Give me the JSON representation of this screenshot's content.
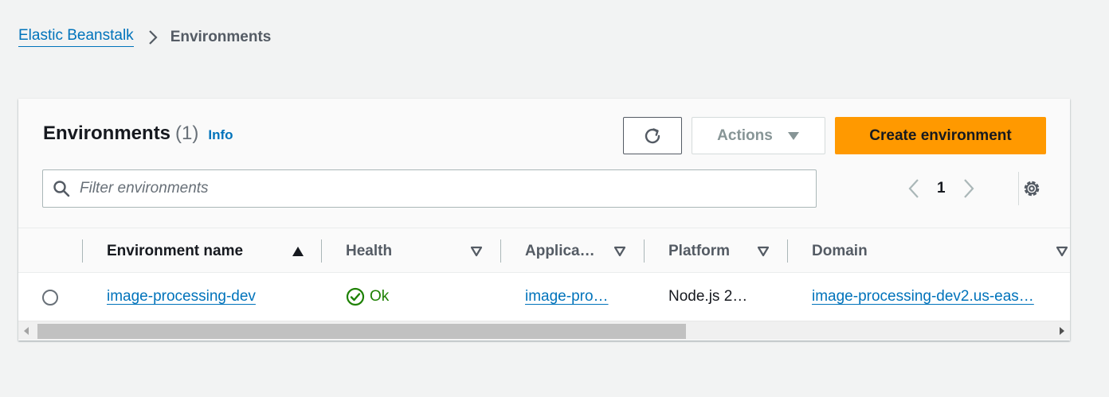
{
  "breadcrumb": {
    "root": "Elastic Beanstalk",
    "current": "Environments"
  },
  "panel": {
    "title": "Environments",
    "count": "(1)",
    "info": "Info",
    "actions_label": "Actions",
    "create_label": "Create environment",
    "filter_placeholder": "Filter environments",
    "page": "1"
  },
  "table": {
    "columns": [
      {
        "label": "Environment name",
        "sort": "ascending"
      },
      {
        "label": "Health"
      },
      {
        "label": "Applica…"
      },
      {
        "label": "Platform"
      },
      {
        "label": "Domain"
      }
    ],
    "rows": [
      {
        "environment_name": "image-processing-dev",
        "health": "Ok",
        "application": "image-pro…",
        "platform": "Node.js 2…",
        "domain": "image-processing-dev2.us-eas…",
        "selected": false
      }
    ]
  },
  "colors": {
    "link": "#0073bb",
    "primary_button": "#ff9900",
    "health_ok": "#1d8102",
    "background": "#f2f3f3"
  },
  "icons": {
    "breadcrumb_separator": "chevron-right-icon",
    "refresh": "refresh-icon",
    "actions_caret": "caret-down-icon",
    "search": "search-icon",
    "pager_prev": "chevron-left-icon",
    "pager_next": "chevron-right-icon",
    "settings": "gear-icon",
    "sort_asc": "sort-ascending-icon",
    "sort": "sort-descending-icon",
    "health_ok": "status-ok-icon"
  }
}
